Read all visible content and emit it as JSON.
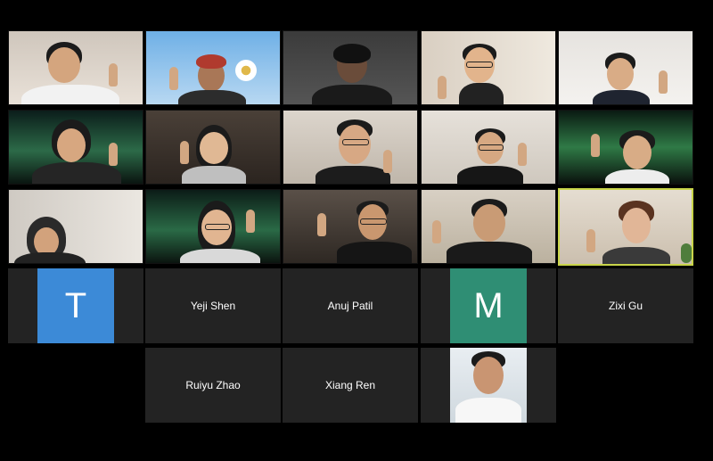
{
  "meeting": {
    "participants": [
      {
        "name": "Yeji Shen"
      },
      {
        "name": "Anuj Patil"
      },
      {
        "name": "Zixi Gu"
      },
      {
        "name": "Ruiyu Zhao"
      },
      {
        "name": "Xiang Ren"
      }
    ],
    "avatars": [
      {
        "initial": "T",
        "color": "#3c8ad7"
      },
      {
        "initial": "M",
        "color": "#2f8e74"
      }
    ],
    "active_speaker_border": "#c9d54a",
    "tile_background": "#232323"
  }
}
